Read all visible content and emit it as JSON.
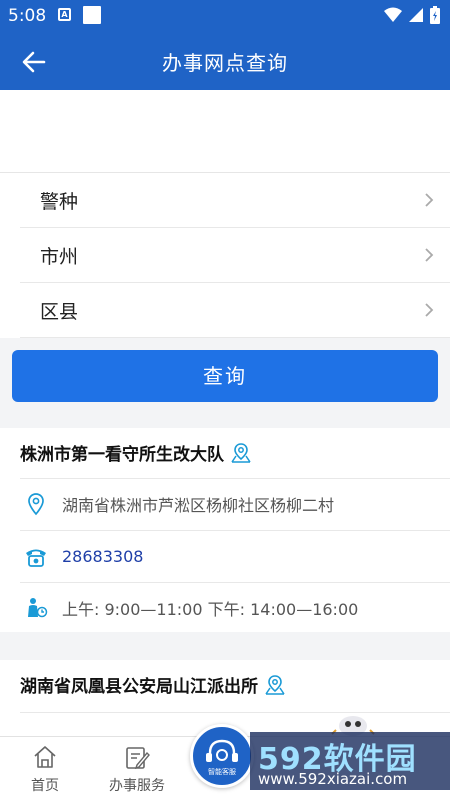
{
  "status_bar": {
    "time": "5:08",
    "notif_letter": "A"
  },
  "app_bar": {
    "title": "办事网点查询"
  },
  "filters": [
    {
      "label": "警种"
    },
    {
      "label": "市州"
    },
    {
      "label": "区县"
    }
  ],
  "query_button": {
    "label": "查询"
  },
  "results": [
    {
      "name": "株洲市第一看守所生改大队",
      "address": "湖南省株洲市芦淞区杨柳社区杨柳二村",
      "phone": "28683308",
      "hours": "上午: 9:00—11:00 下午: 14:00—16:00"
    },
    {
      "name": "湖南省凤凰县公安局山江派出所"
    }
  ],
  "bottom_nav": {
    "home": "首页",
    "services": "办事服务",
    "fab_label": "智能客服"
  },
  "watermark": {
    "brand": "592软件园",
    "url": "www.592xiazai.com"
  },
  "colors": {
    "primary": "#1f63c6",
    "button": "#1f72e6",
    "icon": "#1a9ad6"
  }
}
